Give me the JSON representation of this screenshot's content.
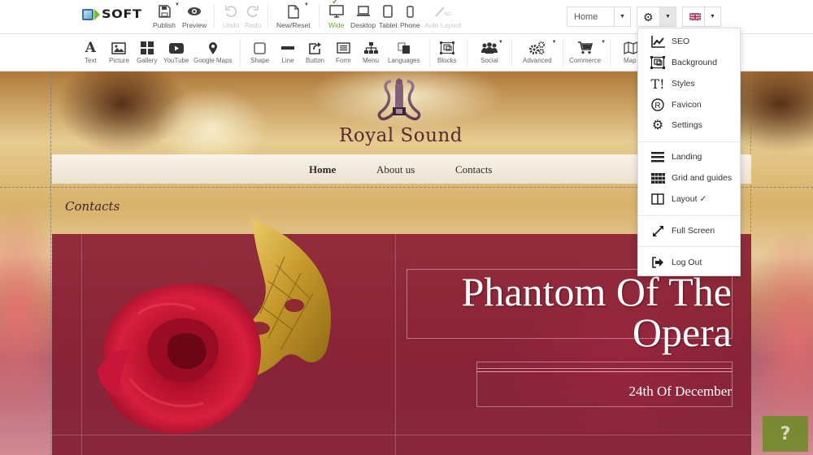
{
  "topbar": {
    "logo_text": "SOFT",
    "buttons": [
      {
        "label": "Publish",
        "icon": "save-icon"
      },
      {
        "label": "Preview",
        "icon": "eye-icon"
      },
      {
        "label": "Undo",
        "icon": "undo-icon",
        "disabled": true
      },
      {
        "label": "Redo",
        "icon": "redo-icon",
        "disabled": true
      },
      {
        "label": "New/Reset",
        "icon": "file-icon"
      },
      {
        "label": "Wide",
        "icon": "monitor-icon",
        "active": true
      },
      {
        "label": "Desktop",
        "icon": "laptop-icon"
      },
      {
        "label": "Tablet",
        "icon": "tablet-icon"
      },
      {
        "label": "Phone",
        "icon": "phone-icon"
      },
      {
        "label": "Auto Layout",
        "icon": "magic-wand-icon",
        "disabled": true,
        "badge": "BETA"
      }
    ],
    "page_select": {
      "value": "Home"
    },
    "settings_select": {
      "icon": "gear-icon"
    },
    "language_select": {
      "icon": "uk-flag-icon"
    }
  },
  "toolbar": {
    "tools": [
      {
        "label": "Text",
        "icon": "text-icon"
      },
      {
        "label": "Picture",
        "icon": "picture-icon"
      },
      {
        "label": "Gallery",
        "icon": "gallery-icon"
      },
      {
        "label": "YouTube",
        "icon": "youtube-icon"
      },
      {
        "label": "Google Maps",
        "icon": "map-pin-icon"
      },
      {
        "label": "Shape",
        "icon": "shape-icon"
      },
      {
        "label": "Line",
        "icon": "line-icon"
      },
      {
        "label": "Button",
        "icon": "button-icon"
      },
      {
        "label": "Form",
        "icon": "form-icon"
      },
      {
        "label": "Menu",
        "icon": "sitemap-icon"
      },
      {
        "label": "Languages",
        "icon": "languages-icon"
      },
      {
        "label": "Blocks",
        "icon": "blocks-icon"
      },
      {
        "label": "Social",
        "icon": "social-icon"
      },
      {
        "label": "Advanced",
        "icon": "cogs-icon"
      },
      {
        "label": "Commerce",
        "icon": "cart-icon"
      },
      {
        "label": "Map",
        "icon": "map-icon"
      }
    ]
  },
  "settings_menu": {
    "items": [
      {
        "label": "SEO",
        "icon": "chart-line-icon"
      },
      {
        "label": "Background",
        "icon": "background-icon"
      },
      {
        "label": "Styles",
        "icon": "styles-icon"
      },
      {
        "label": "Favicon",
        "icon": "registered-icon"
      },
      {
        "label": "Settings",
        "icon": "gear-icon"
      },
      {
        "label": "Landing",
        "icon": "hamburger-icon"
      },
      {
        "label": "Grid and guides",
        "icon": "grid-icon"
      },
      {
        "label": "Layout ✓",
        "icon": "columns-icon"
      },
      {
        "label": "Full Screen",
        "icon": "expand-icon"
      },
      {
        "label": "Log Out",
        "icon": "logout-icon"
      }
    ]
  },
  "site": {
    "brand": "Royal Sound",
    "nav": [
      "Home",
      "About us",
      "Contacts"
    ],
    "section_heading": "Contacts",
    "banner_title_line1": "Phantom Of The",
    "banner_title_line2": "Opera",
    "banner_date": "24th Of December"
  },
  "help": {
    "label": "?"
  },
  "colors": {
    "active_green": "#6aaa2a",
    "banner_red": "#8a1e34",
    "brand_text": "#5b2a2e",
    "help_green": "#6e8c28"
  }
}
